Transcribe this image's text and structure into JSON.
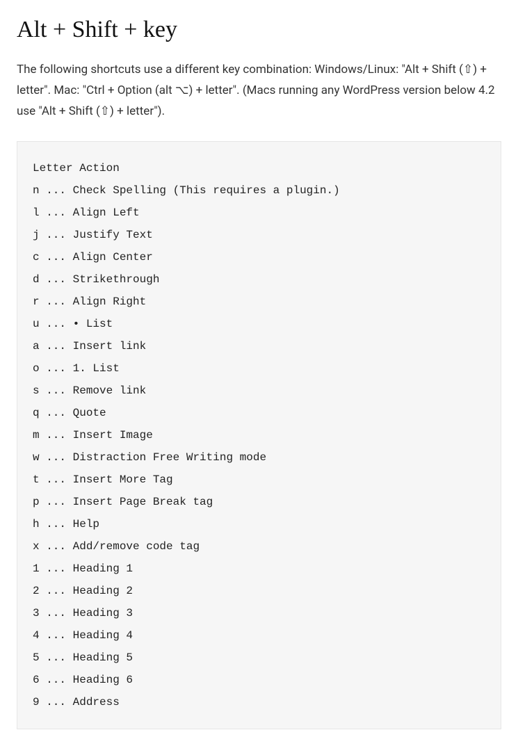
{
  "heading": "Alt + Shift + key",
  "intro": "The following shortcuts use a different key combination: Windows/Linux: \"Alt + Shift (⇧) + letter\". Mac: \"Ctrl + Option (alt ⌥) + letter\". (Macs running any WordPress version below 4.2 use \"Alt + Shift (⇧) + letter\").",
  "code_header": "Letter Action",
  "shortcuts": [
    {
      "letter": "n",
      "action": "Check Spelling (This requires a plugin.)"
    },
    {
      "letter": "l",
      "action": "Align Left"
    },
    {
      "letter": "j",
      "action": "Justify Text"
    },
    {
      "letter": "c",
      "action": "Align Center"
    },
    {
      "letter": "d",
      "action": "Strikethrough"
    },
    {
      "letter": "r",
      "action": "Align Right"
    },
    {
      "letter": "u",
      "action": "• List"
    },
    {
      "letter": "a",
      "action": "Insert link"
    },
    {
      "letter": "o",
      "action": "1. List"
    },
    {
      "letter": "s",
      "action": "Remove link"
    },
    {
      "letter": "q",
      "action": "Quote"
    },
    {
      "letter": "m",
      "action": "Insert Image"
    },
    {
      "letter": "w",
      "action": "Distraction Free Writing mode"
    },
    {
      "letter": "t",
      "action": "Insert More Tag"
    },
    {
      "letter": "p",
      "action": "Insert Page Break tag"
    },
    {
      "letter": "h",
      "action": "Help"
    },
    {
      "letter": "x",
      "action": "Add/remove code tag"
    },
    {
      "letter": "1",
      "action": "Heading 1"
    },
    {
      "letter": "2",
      "action": "Heading 2"
    },
    {
      "letter": "3",
      "action": "Heading 3"
    },
    {
      "letter": "4",
      "action": "Heading 4"
    },
    {
      "letter": "5",
      "action": "Heading 5"
    },
    {
      "letter": "6",
      "action": "Heading 6"
    },
    {
      "letter": "9",
      "action": "Address"
    }
  ]
}
